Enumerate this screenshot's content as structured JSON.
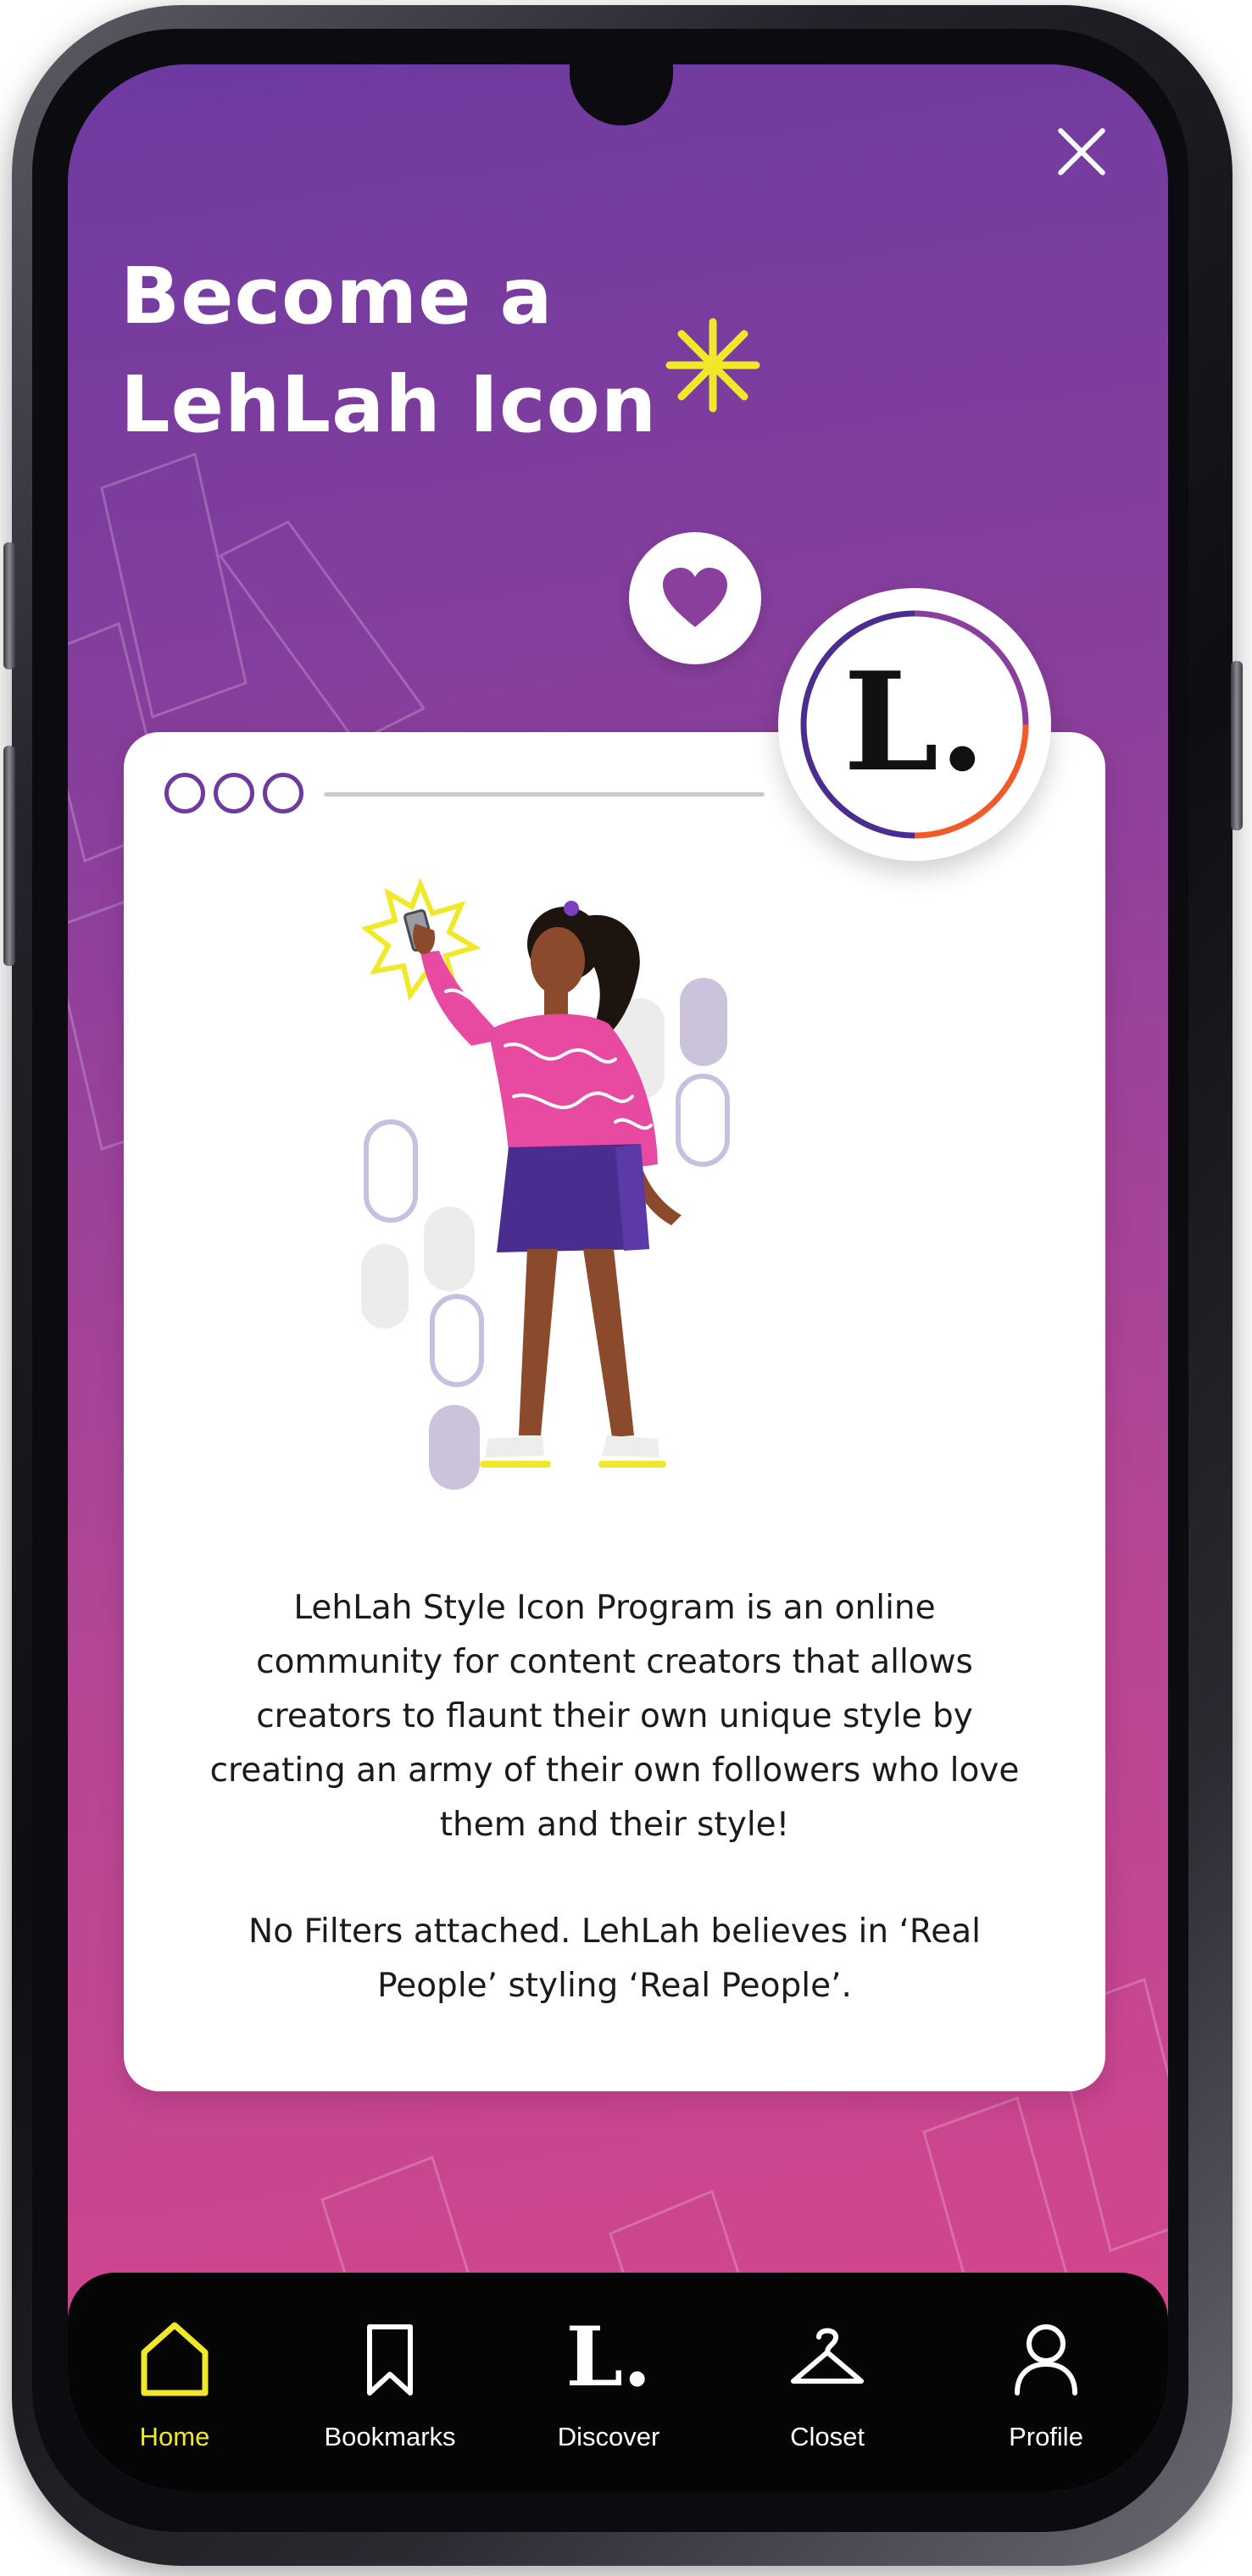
{
  "header": {
    "title_line1": "Become a",
    "title_line2": "LehLah Icon"
  },
  "card": {
    "paragraph1": "LehLah Style Icon Program is an online community for content creators that allows creators to flaunt their own unique style by creating an army of their own followers who love them and their style!",
    "paragraph2": "No Filters attached. LehLah believes in ‘Real People’ styling ‘Real People’."
  },
  "logo": {
    "mark": "L."
  },
  "nav": {
    "items": [
      {
        "label": "Home",
        "icon": "home-icon",
        "active": true
      },
      {
        "label": "Bookmarks",
        "icon": "bookmark-icon",
        "active": false
      },
      {
        "label": "Discover",
        "icon": "lehlah-logo-icon",
        "active": false
      },
      {
        "label": "Closet",
        "icon": "hanger-icon",
        "active": false
      },
      {
        "label": "Profile",
        "icon": "profile-icon",
        "active": false
      }
    ]
  },
  "colors": {
    "gradient_top": "#6d3aa1",
    "gradient_bottom": "#d9468a",
    "accent_yellow": "#f1e82a",
    "nav_background": "#050505",
    "card_background": "#ffffff"
  }
}
